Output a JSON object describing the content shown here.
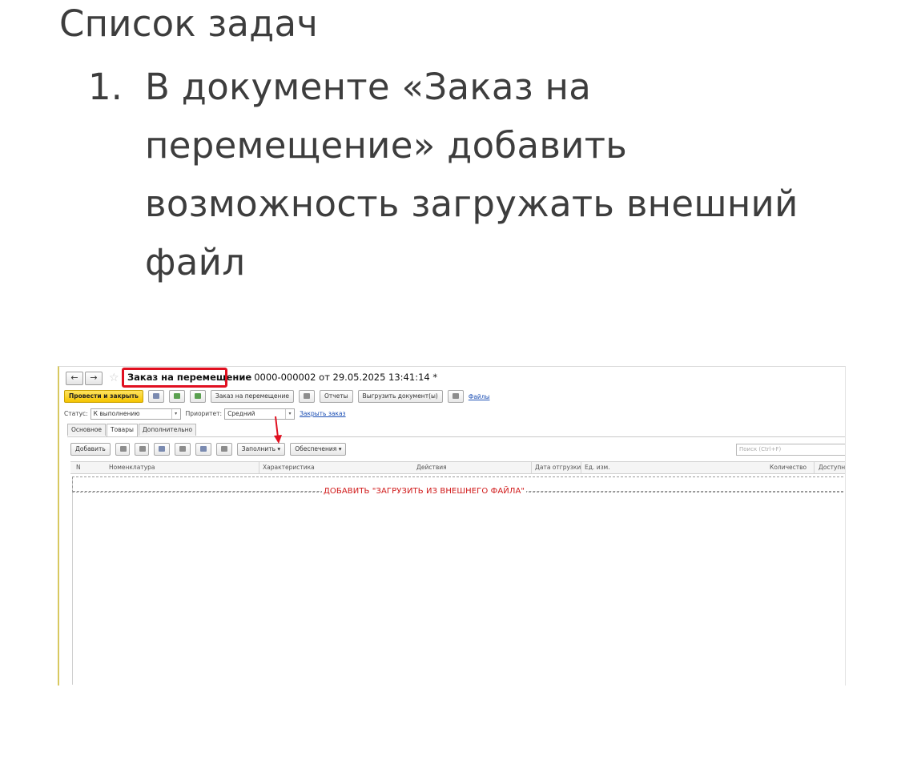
{
  "page": {
    "heading": "Список задач",
    "tasks": [
      {
        "number": "1.",
        "text": "В документе «Заказ на перемещение» добавить возможность загружать внешний файл"
      }
    ]
  },
  "screenshot": {
    "nav": {
      "back": "←",
      "forward": "→"
    },
    "doc_title": "Заказ на перемещение",
    "doc_number": "0000-000002 от 29.05.2025 13:41:14 *",
    "toolbar": {
      "post_close": "Провести и закрыть",
      "transfer_order_print": "Заказ на перемещение",
      "reports": "Отчеты",
      "export_docs": "Выгрузить документ(ы)",
      "files_link": "Файлы"
    },
    "status_label": "Статус:",
    "status_value": "К выполнению",
    "priority_label": "Приоритет:",
    "priority_value": "Средний",
    "close_order_link": "Закрыть заказ",
    "tabs": [
      "Основное",
      "Товары",
      "Дополнительно"
    ],
    "table_toolbar": {
      "add": "Добавить",
      "fill": "Заполнить",
      "provision": "Обеспечения",
      "search_placeholder": "Поиск (Ctrl+F)"
    },
    "columns": [
      "N",
      "Номенклатура",
      "Характеристика",
      "Действия",
      "Дата отгрузки",
      "Ед. изм.",
      "Количество",
      "Доступн"
    ],
    "annotation": "ДОБАВИТЬ \"ЗАГРУЗИТЬ ИЗ ВНЕШНЕГО ФАЙЛА\"",
    "colors": {
      "highlight": "#e01020",
      "post_button": "#f5c400",
      "link": "#1c4fb4"
    }
  }
}
